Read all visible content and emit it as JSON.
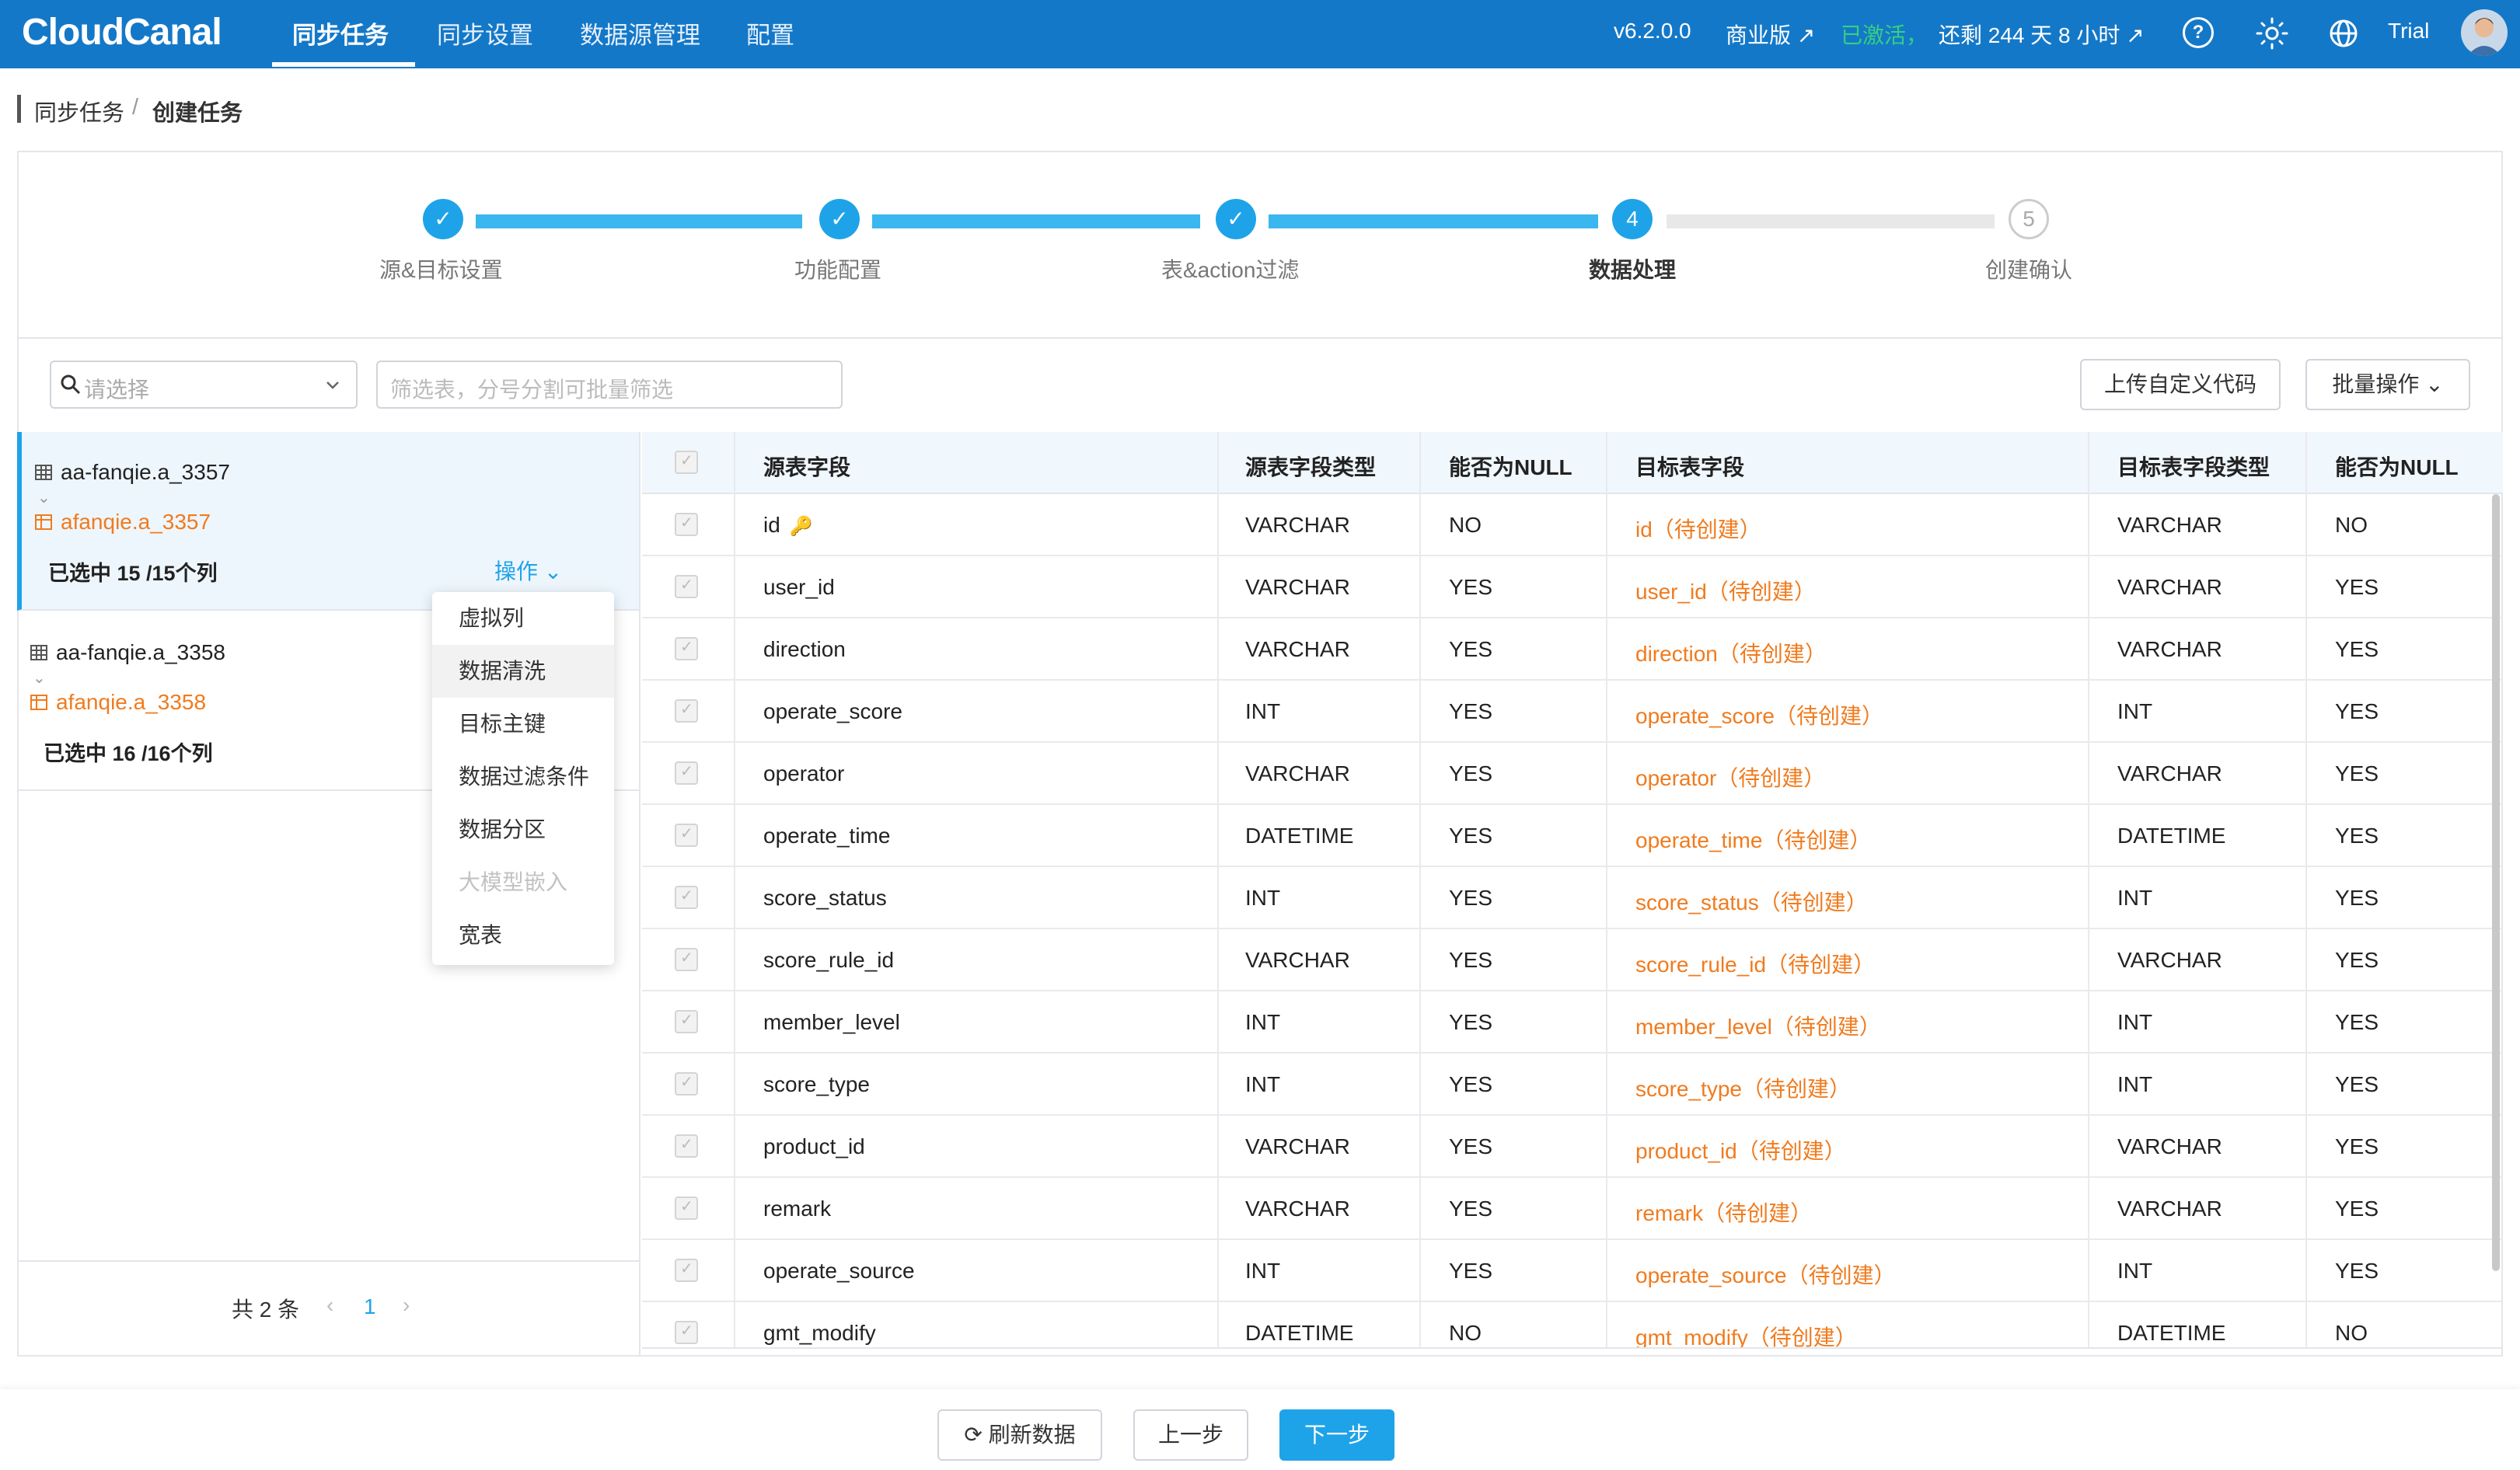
{
  "header": {
    "logo": "CloudCanal",
    "nav": [
      "同步任务",
      "同步设置",
      "数据源管理",
      "配置"
    ],
    "version": "v6.2.0.0",
    "edition": "商业版 ↗",
    "activated": "已激活，",
    "remaining": "还剩 244 天 8 小时 ↗",
    "trial": "Trial",
    "help_icon": "help-circle-icon",
    "theme_icon": "sun-icon",
    "lang_icon": "globe-icon"
  },
  "breadcrumb": {
    "root": "同步任务",
    "sep": "/",
    "current": "创建任务"
  },
  "steps": [
    {
      "label": "源&目标设置",
      "marker": "✓",
      "state": "done"
    },
    {
      "label": "功能配置",
      "marker": "✓",
      "state": "done"
    },
    {
      "label": "表&action过滤",
      "marker": "✓",
      "state": "done"
    },
    {
      "label": "数据处理",
      "marker": "4",
      "state": "current"
    },
    {
      "label": "创建确认",
      "marker": "5",
      "state": "todo"
    }
  ],
  "filters": {
    "select_placeholder": "请选择",
    "table_filter_placeholder": "筛选表，分号分割可批量筛选",
    "upload_button": "上传自定义代码",
    "batch_button": "批量操作 ⌄"
  },
  "tables": [
    {
      "source": "aa-fanqie.a_3357",
      "target": "afanqie.a_3357",
      "selected": "已选中 15 /15个列",
      "op": "操作 ⌄"
    },
    {
      "source": "aa-fanqie.a_3358",
      "target": "afanqie.a_3358",
      "selected": "已选中 16 /16个列"
    }
  ],
  "dropdown": [
    "虚拟列",
    "数据清洗",
    "目标主键",
    "数据过滤条件",
    "数据分区",
    "大模型嵌入",
    "宽表"
  ],
  "pager": {
    "total": "共 2 条",
    "page": "1",
    "prev": "‹",
    "next": "›"
  },
  "columns_header": [
    "源表字段",
    "源表字段类型",
    "能否为NULL",
    "目标表字段",
    "目标表字段类型",
    "能否为NULL"
  ],
  "rows": [
    {
      "src": "id",
      "type": "VARCHAR",
      "null": "NO",
      "dst": "id（待创建）",
      "dtype": "VARCHAR",
      "dnull": "NO",
      "key": true
    },
    {
      "src": "user_id",
      "type": "VARCHAR",
      "null": "YES",
      "dst": "user_id（待创建）",
      "dtype": "VARCHAR",
      "dnull": "YES"
    },
    {
      "src": "direction",
      "type": "VARCHAR",
      "null": "YES",
      "dst": "direction（待创建）",
      "dtype": "VARCHAR",
      "dnull": "YES"
    },
    {
      "src": "operate_score",
      "type": "INT",
      "null": "YES",
      "dst": "operate_score（待创建）",
      "dtype": "INT",
      "dnull": "YES"
    },
    {
      "src": "operator",
      "type": "VARCHAR",
      "null": "YES",
      "dst": "operator（待创建）",
      "dtype": "VARCHAR",
      "dnull": "YES"
    },
    {
      "src": "operate_time",
      "type": "DATETIME",
      "null": "YES",
      "dst": "operate_time（待创建）",
      "dtype": "DATETIME",
      "dnull": "YES"
    },
    {
      "src": "score_status",
      "type": "INT",
      "null": "YES",
      "dst": "score_status（待创建）",
      "dtype": "INT",
      "dnull": "YES"
    },
    {
      "src": "score_rule_id",
      "type": "VARCHAR",
      "null": "YES",
      "dst": "score_rule_id（待创建）",
      "dtype": "VARCHAR",
      "dnull": "YES"
    },
    {
      "src": "member_level",
      "type": "INT",
      "null": "YES",
      "dst": "member_level（待创建）",
      "dtype": "INT",
      "dnull": "YES"
    },
    {
      "src": "score_type",
      "type": "INT",
      "null": "YES",
      "dst": "score_type（待创建）",
      "dtype": "INT",
      "dnull": "YES"
    },
    {
      "src": "product_id",
      "type": "VARCHAR",
      "null": "YES",
      "dst": "product_id（待创建）",
      "dtype": "VARCHAR",
      "dnull": "YES"
    },
    {
      "src": "remark",
      "type": "VARCHAR",
      "null": "YES",
      "dst": "remark（待创建）",
      "dtype": "VARCHAR",
      "dnull": "YES"
    },
    {
      "src": "operate_source",
      "type": "INT",
      "null": "YES",
      "dst": "operate_source（待创建）",
      "dtype": "INT",
      "dnull": "YES"
    },
    {
      "src": "gmt_modify",
      "type": "DATETIME",
      "null": "NO",
      "dst": "gmt_modify（待创建）",
      "dtype": "DATETIME",
      "dnull": "NO"
    }
  ],
  "footer": {
    "refresh": "⟳ 刷新数据",
    "prev": "上一步",
    "next": "下一步"
  },
  "colors": {
    "brand": "#1478c8",
    "accent": "#1fa3e8",
    "target": "#f07b1e"
  }
}
